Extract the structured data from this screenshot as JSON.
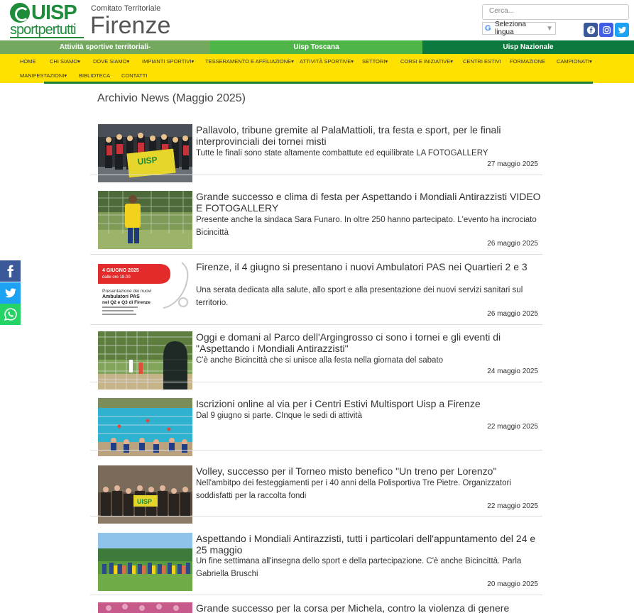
{
  "header": {
    "logo_word": "UISP",
    "logo_sub": "sportpertutti",
    "comitato": "Comitato Territoriale",
    "city": "Firenze",
    "search_placeholder": "Cerca...",
    "language_label": "Seleziona lingua",
    "language_arrow": "▼"
  },
  "bars": [
    {
      "label": "Attività sportive territoriali-",
      "color": "#74a85f"
    },
    {
      "label": "Uisp Toscana",
      "color": "#4fb548"
    },
    {
      "label": "Uisp Nazionale",
      "color": "#0c7a3e"
    }
  ],
  "nav": {
    "row1": [
      "HOME",
      "CHI SIAMO",
      "DOVE SIAMO",
      "IMPIANTI SPORTIVI",
      "TESSERAMENTO E AFFILIAZIONE",
      "ATTIVITÀ SPORTIVE",
      "SETTORI",
      "CORSI E INIZIATIVE",
      "CENTRI ESTIVI",
      "FORMAZIONE",
      "CAMPIONATI"
    ],
    "row2": [
      "MANIFESTAZIONI",
      "BIBLIOTECA",
      "CONTATTI"
    ],
    "dropdown_marker": "▾"
  },
  "page_title": "Archivio News (Maggio 2025)",
  "news": [
    {
      "title": "Pallavolo, tribune gremite al PalaMattioli, tra festa e sport, per le finali interprovinciali dei tornei misti",
      "summary": "Tutte le finali sono state altamente combattute ed equilibrate LA FOTOGALLERY",
      "date": "27 maggio 2025"
    },
    {
      "title": "Grande successo e clima di festa per Aspettando i Mondiali Antirazzisti VIDEO E FOTOGALLERY",
      "summary": "Presente anche la sindaca Sara Funaro. In oltre 250 hanno partecipato. L'evento ha incrociato Bicincittà",
      "date": "26 maggio 2025"
    },
    {
      "title": "Firenze, il 4 giugno si presentano i nuovi Ambulatori PAS nei Quartieri 2 e 3",
      "summary": "Una serata dedicata alla salute, allo sport e alla presentazione dei nuovi servizi sanitari sul territorio.",
      "date": "26 maggio 2025"
    },
    {
      "title": "Oggi e domani al Parco dell'Argingrosso ci sono i tornei e gli eventi di \"Aspettando i Mondiali Antirazzisti\"",
      "summary": "C'è anche Bicincittà che si unisce alla festa nella giornata del sabato",
      "date": "24 maggio 2025"
    },
    {
      "title": "Iscrizioni online al via per i Centri Estivi Multisport Uisp a Firenze",
      "summary": "Dal 9 giugno si parte. CInque le sedi di attività",
      "date": "22 maggio 2025"
    },
    {
      "title": "Volley, successo per il Torneo misto benefico \"Un treno per Lorenzo\"",
      "summary": "Nell'ambitpo dei festeggiamenti per i 40 anni della Polisportiva Tre Pietre. Organizzatori soddisfatti per la raccolta fondi",
      "date": "22 maggio 2025"
    },
    {
      "title": "Aspettando i Mondiali Antirazzisti, tutti i particolari dell'appuntamento del 24 e 25 maggio",
      "summary": "Un fine settimana all'insegna dello sport e della partecipazione. C'è anche Bicincittà. Parla Gabriella Bruschi",
      "date": "20 maggio 2025"
    },
    {
      "title": "Grande successo per la corsa per Michela, contro la violenza di genere",
      "summary": "",
      "date": ""
    }
  ],
  "thumb3": {
    "date_line": "4 GIUGNO 2025",
    "time_line": "dalle ore 18.00",
    "heading1": "Presentazione dei nuovi",
    "heading2": "Ambulatori PAS",
    "heading3": "nel Q2 e Q3 di Firenze"
  },
  "thumb1_banner": "UISP",
  "thumb6_banner": "UISP"
}
